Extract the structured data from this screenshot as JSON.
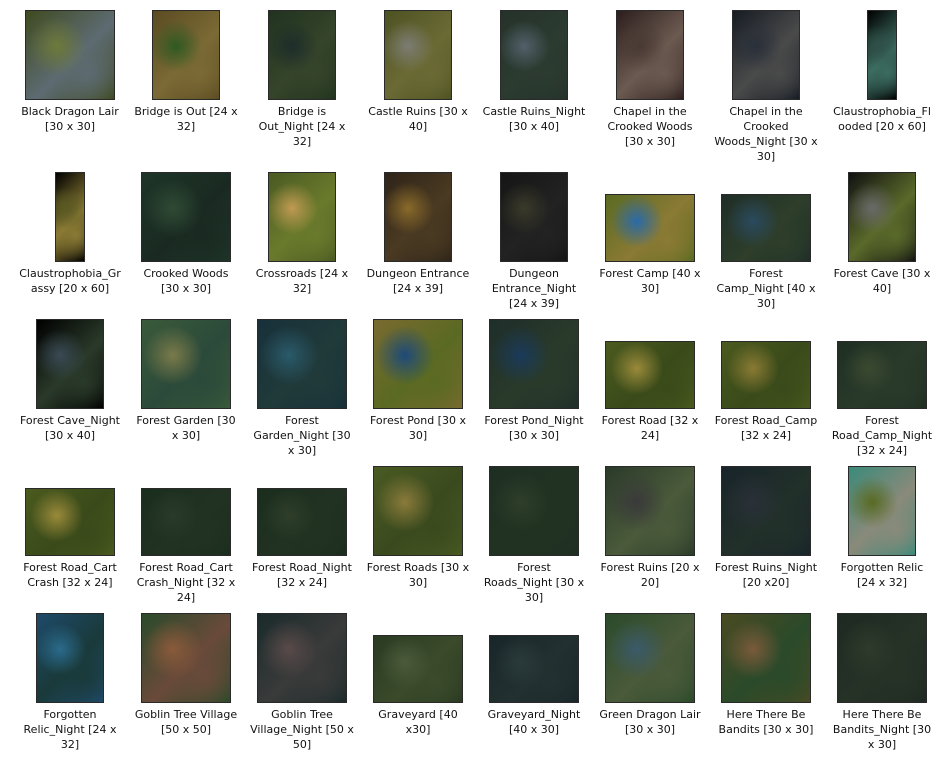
{
  "files": [
    {
      "name": "Black Dragon Lair [30 x 30]",
      "thumb": "square",
      "palette": [
        "#3f4a1f",
        "#6d7a3a",
        "#5d6b72"
      ]
    },
    {
      "name": "Bridge is Out [24 x 32]",
      "thumb": "tall",
      "palette": [
        "#5a4b22",
        "#2f5a22",
        "#7b6a35"
      ]
    },
    {
      "name": "Bridge is Out_Night [24 x 32]",
      "thumb": "tall",
      "palette": [
        "#21331f",
        "#1e2d2a",
        "#35442a"
      ]
    },
    {
      "name": "Castle Ruins [30 x 40]",
      "thumb": "tall",
      "palette": [
        "#4d5222",
        "#7c7c74",
        "#6b6a35"
      ]
    },
    {
      "name": "Castle Ruins_Night [30 x 40]",
      "thumb": "tall",
      "palette": [
        "#24322a",
        "#52606a",
        "#2c3b30"
      ]
    },
    {
      "name": "Chapel in the Crooked Woods [30 x 30]",
      "thumb": "tall",
      "palette": [
        "#2c1e1e",
        "#4a3a34",
        "#6b5a50"
      ]
    },
    {
      "name": "Chapel in the Crooked Woods_Night [30 x 30]",
      "thumb": "tall",
      "palette": [
        "#161c24",
        "#2a303a",
        "#4a4a4a"
      ]
    },
    {
      "name": "Claustrophobia_Flooded [20 x 60]",
      "thumb": "narrow",
      "palette": [
        "#000000",
        "#2f5048",
        "#3c6c60"
      ]
    },
    {
      "name": "Claustrophobia_Grassy [20 x 60]",
      "thumb": "narrow",
      "palette": [
        "#000000",
        "#5a5a22",
        "#8a7a34"
      ]
    },
    {
      "name": "Crooked Woods [30 x 30]",
      "thumb": "square",
      "palette": [
        "#1e3528",
        "#2f4a34",
        "#1a2a22"
      ]
    },
    {
      "name": "Crossroads [24 x 32]",
      "thumb": "tall",
      "palette": [
        "#4a5a22",
        "#c09a52",
        "#6a7a2c"
      ]
    },
    {
      "name": "Dungeon Entrance [24 x 39]",
      "thumb": "tall",
      "palette": [
        "#2e2418",
        "#8a6a2a",
        "#4a3a22"
      ]
    },
    {
      "name": "Dungeon Entrance_Night [24 x 39]",
      "thumb": "tall",
      "palette": [
        "#151515",
        "#3a3a2a",
        "#222222"
      ]
    },
    {
      "name": "Forest Camp [40 x 30]",
      "thumb": "wide",
      "palette": [
        "#5a6a22",
        "#2a6aa8",
        "#8a7a34"
      ]
    },
    {
      "name": "Forest Camp_Night [40 x 30]",
      "thumb": "wide",
      "palette": [
        "#1e2e28",
        "#2a4a60",
        "#2e3e2a"
      ]
    },
    {
      "name": "Forest Cave [30 x 40]",
      "thumb": "tall",
      "palette": [
        "#111111",
        "#6a6a6a",
        "#5a6a2a"
      ]
    },
    {
      "name": "Forest Cave_Night [30 x 40]",
      "thumb": "tall",
      "palette": [
        "#000000",
        "#3a4a55",
        "#2a3a2a"
      ]
    },
    {
      "name": "Forest Garden [30 x 30]",
      "thumb": "square",
      "palette": [
        "#3a5a3a",
        "#7a7a4a",
        "#2c4a3a"
      ]
    },
    {
      "name": "Forest Garden_Night [30 x 30]",
      "thumb": "square",
      "palette": [
        "#18303a",
        "#2a5a6a",
        "#203a3a"
      ]
    },
    {
      "name": "Forest Pond [30 x 30]",
      "thumb": "square",
      "palette": [
        "#7a6a30",
        "#1e4a7a",
        "#5a6a22"
      ]
    },
    {
      "name": "Forest Pond_Night [30 x 30]",
      "thumb": "square",
      "palette": [
        "#1e2e2a",
        "#1a3a5a",
        "#2a3a2a"
      ]
    },
    {
      "name": "Forest Road [32 x 24]",
      "thumb": "wide",
      "palette": [
        "#4a5a1e",
        "#9a8a3a",
        "#3a4a1a"
      ]
    },
    {
      "name": "Forest Road_Camp [32 x 24]",
      "thumb": "wide",
      "palette": [
        "#4a5a1e",
        "#8a7a34",
        "#3a4a1a"
      ]
    },
    {
      "name": "Forest Road_Camp_Night [32 x 24]",
      "thumb": "wide",
      "palette": [
        "#1e2e22",
        "#3a4a30",
        "#2a3a2a"
      ]
    },
    {
      "name": "Forest Road_Cart Crash [32 x 24]",
      "thumb": "wide",
      "palette": [
        "#4a5a1e",
        "#9a8a3a",
        "#3a4a1a"
      ]
    },
    {
      "name": "Forest Road_Cart Crash_Night [32 x 24]",
      "thumb": "wide",
      "palette": [
        "#1a2e1e",
        "#2a3a2a",
        "#223222"
      ]
    },
    {
      "name": "Forest Road_Night [32 x 24]",
      "thumb": "wide",
      "palette": [
        "#1a2e1e",
        "#2e3e2a",
        "#223222"
      ]
    },
    {
      "name": "Forest Roads [30 x 30]",
      "thumb": "square",
      "palette": [
        "#4a5a22",
        "#8a7a3a",
        "#3a4a1e"
      ]
    },
    {
      "name": "Forest Roads_Night [30 x 30]",
      "thumb": "square",
      "palette": [
        "#1e2e22",
        "#2e3e2a",
        "#223222"
      ]
    },
    {
      "name": "Forest Ruins [20 x 20]",
      "thumb": "square",
      "palette": [
        "#2a3a2a",
        "#3a3a3a",
        "#4a5a3a"
      ]
    },
    {
      "name": "Forest Ruins_Night [20 x20]",
      "thumb": "square",
      "palette": [
        "#18242a",
        "#2a3038",
        "#22302a"
      ]
    },
    {
      "name": "Forgotten Relic [24 x 32]",
      "thumb": "tall",
      "palette": [
        "#3a8a7a",
        "#5a6a22",
        "#8a8a7a"
      ]
    },
    {
      "name": "Forgotten Relic_Night [24 x 32]",
      "thumb": "tall",
      "palette": [
        "#1e4a6a",
        "#2a6a8a",
        "#1a3a3a"
      ]
    },
    {
      "name": "Goblin Tree Village [50 x 50]",
      "thumb": "square",
      "palette": [
        "#2a4a2a",
        "#8a5a3a",
        "#6a4a3a"
      ]
    },
    {
      "name": "Goblin Tree Village_Night [50 x 50]",
      "thumb": "square",
      "palette": [
        "#1a2a2a",
        "#5a4a4a",
        "#3a3a3a"
      ]
    },
    {
      "name": "Graveyard [40 x30]",
      "thumb": "wide",
      "palette": [
        "#2a3a22",
        "#4a5a3a",
        "#3a4a2a"
      ]
    },
    {
      "name": "Graveyard_Night [40 x 30]",
      "thumb": "wide",
      "palette": [
        "#18262a",
        "#2a3a3a",
        "#223030"
      ]
    },
    {
      "name": "Green Dragon Lair [30 x 30]",
      "thumb": "square",
      "palette": [
        "#2a4a2a",
        "#3a5a6a",
        "#4a5a3a"
      ]
    },
    {
      "name": "Here There Be Bandits [30 x 30]",
      "thumb": "square",
      "palette": [
        "#4a4a22",
        "#7a5a3a",
        "#2a4a2a"
      ]
    },
    {
      "name": "Here There Be Bandits_Night [30 x 30]",
      "thumb": "square",
      "palette": [
        "#1e2a22",
        "#2e3a2a",
        "#263226"
      ]
    }
  ]
}
